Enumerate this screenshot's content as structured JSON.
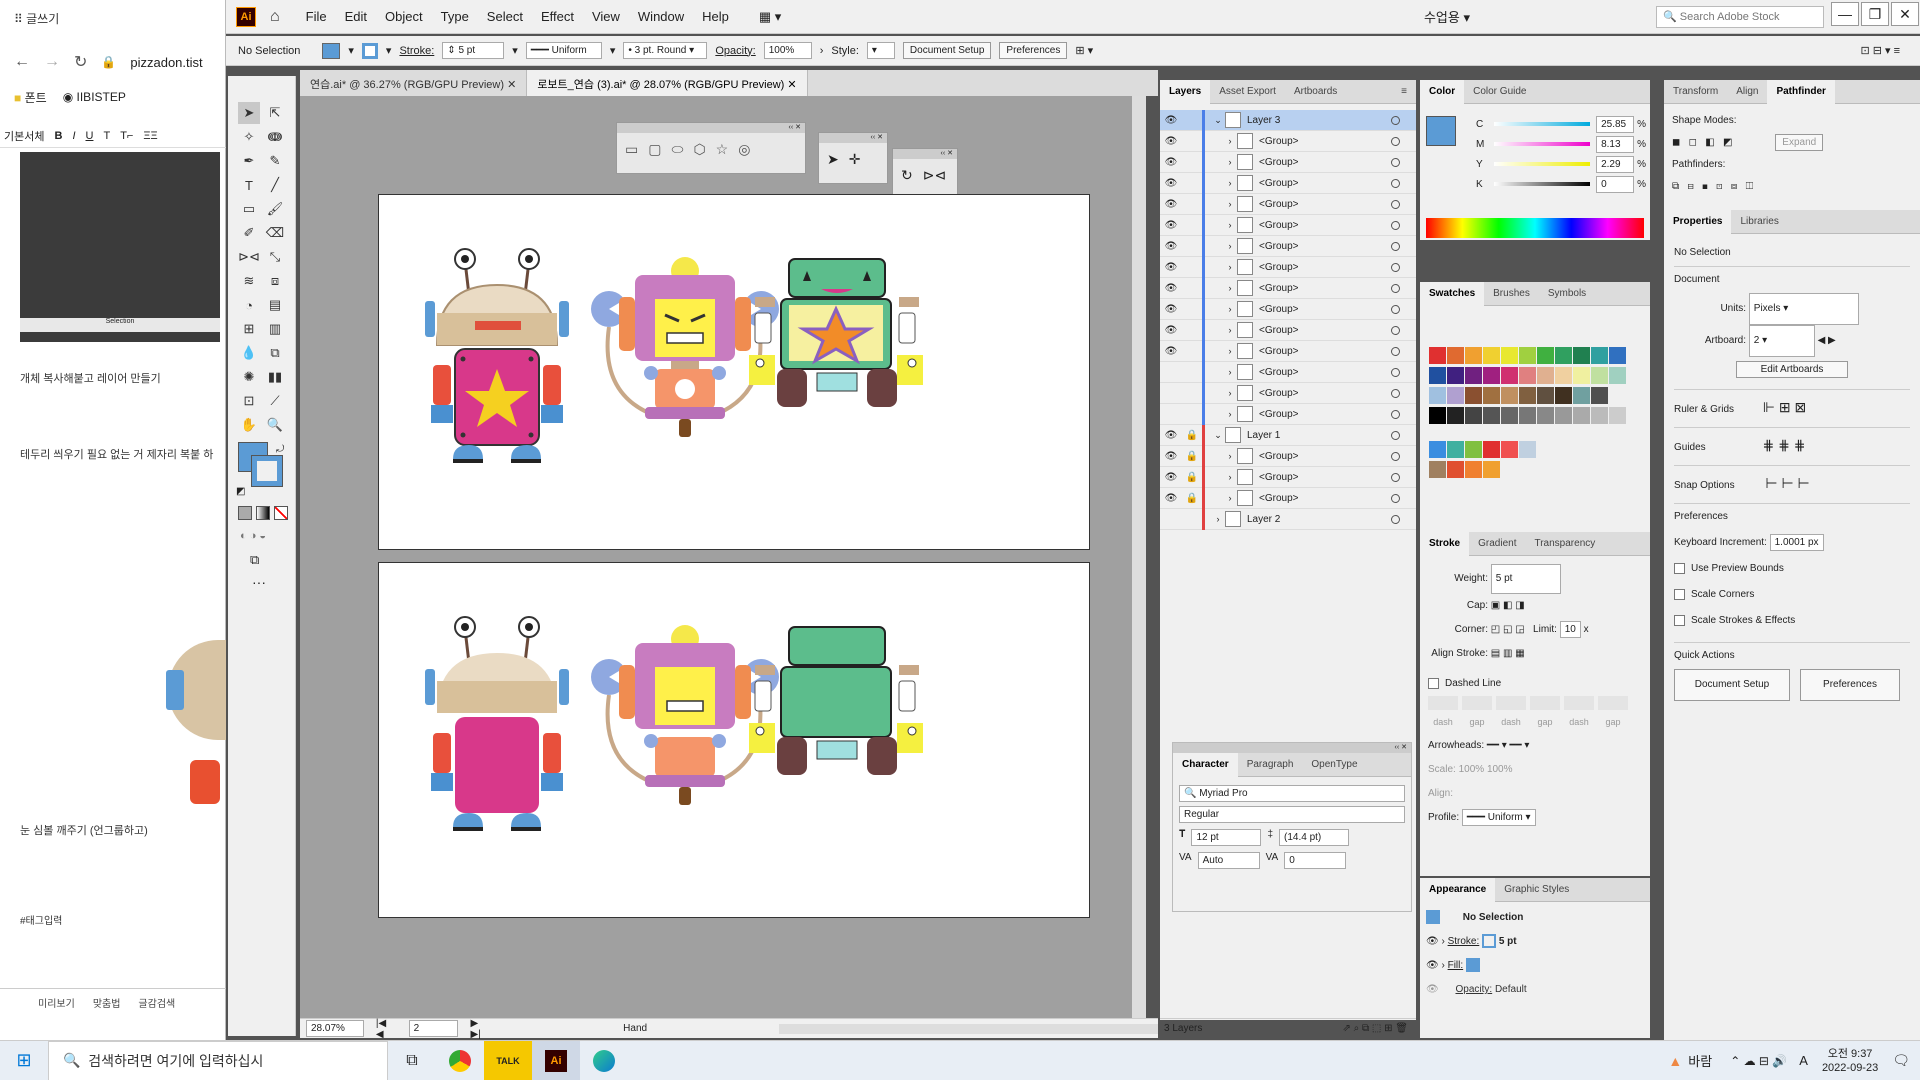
{
  "browser": {
    "tab_title": "글쓰기",
    "url": "pizzadon.tist",
    "bookmarks": [
      "폰트",
      "IIBISTEP"
    ],
    "editor_items": [
      "기본서체",
      "B",
      "I",
      "U",
      "T",
      "T⌐",
      "ΞΞ"
    ],
    "thumb_label": "Selection",
    "post_lines": [
      "개체 복사해붙고 레이어 만들기",
      "테두리 씌우기 필요 없는 거 제자리 복붙 하",
      "눈 심볼 깨주기 (언그룹하고)",
      "#태그입력"
    ],
    "footer": [
      "미리보기",
      "맞춤법",
      "글감검색"
    ]
  },
  "menubar": {
    "logo": "Ai",
    "items": [
      "File",
      "Edit",
      "Object",
      "Type",
      "Select",
      "Effect",
      "View",
      "Window",
      "Help"
    ],
    "workspace": "수업용",
    "search_placeholder": "Search Adobe Stock",
    "win_buttons": [
      "—",
      "❐",
      "✕"
    ]
  },
  "control": {
    "selection": "No Selection",
    "stroke_label": "Stroke:",
    "stroke_value": "5 pt",
    "stroke_style": "Uniform",
    "brush": "3 pt. Round",
    "opacity_label": "Opacity:",
    "opacity": "100%",
    "style_label": "Style:",
    "doc_setup": "Document Setup",
    "preferences": "Preferences"
  },
  "doc_tabs": [
    {
      "label": "연습.ai* @ 36.27% (RGB/GPU Preview)",
      "close": "✕"
    },
    {
      "label": "로보트_연습 (3).ai* @ 28.07% (RGB/GPU Preview)",
      "close": "✕"
    }
  ],
  "status": {
    "zoom": "28.07%",
    "artboard": "2",
    "tool": "Hand"
  },
  "layers_panel": {
    "tabs": [
      "Layers",
      "Asset Export",
      "Artboards"
    ],
    "rows": [
      {
        "name": "Layer 3",
        "level": 0,
        "lock": false,
        "eye": true,
        "open": true
      },
      {
        "name": "<Group>",
        "level": 1,
        "eye": true
      },
      {
        "name": "<Group>",
        "level": 1,
        "eye": true
      },
      {
        "name": "<Group>",
        "level": 1,
        "eye": true
      },
      {
        "name": "<Group>",
        "level": 1,
        "eye": true
      },
      {
        "name": "<Group>",
        "level": 1,
        "eye": true
      },
      {
        "name": "<Group>",
        "level": 1,
        "eye": true
      },
      {
        "name": "<Group>",
        "level": 1,
        "eye": true
      },
      {
        "name": "<Group>",
        "level": 1,
        "eye": true
      },
      {
        "name": "<Group>",
        "level": 1,
        "eye": true
      },
      {
        "name": "<Group>",
        "level": 1,
        "eye": true
      },
      {
        "name": "<Group>",
        "level": 1,
        "eye": true
      },
      {
        "name": "<Group>",
        "level": 1,
        "eye": false
      },
      {
        "name": "<Group>",
        "level": 1,
        "eye": false
      },
      {
        "name": "<Group>",
        "level": 1,
        "eye": false
      },
      {
        "name": "Layer 1",
        "level": 0,
        "lock": true,
        "eye": true,
        "open": true
      },
      {
        "name": "<Group>",
        "level": 1,
        "eye": true,
        "lock": true
      },
      {
        "name": "<Group>",
        "level": 1,
        "eye": true,
        "lock": true
      },
      {
        "name": "<Group>",
        "level": 1,
        "eye": true,
        "lock": true
      },
      {
        "name": "Layer 2",
        "level": 0,
        "eye": false,
        "open": false
      }
    ],
    "footer": "3 Layers"
  },
  "character_panel": {
    "tabs": [
      "Character",
      "Paragraph",
      "OpenType"
    ],
    "font": "Myriad Pro",
    "style": "Regular",
    "size": "12 pt",
    "leading": "(14.4 pt)",
    "kerning": "Auto",
    "tracking": "0"
  },
  "color_panel": {
    "tabs": [
      "Color",
      "Color Guide"
    ],
    "channels": [
      {
        "k": "C",
        "v": "25.85"
      },
      {
        "k": "M",
        "v": "8.13"
      },
      {
        "k": "Y",
        "v": "2.29"
      },
      {
        "k": "K",
        "v": "0"
      }
    ],
    "unit": "%"
  },
  "swatches_panel": {
    "tabs": [
      "Swatches",
      "Brushes",
      "Symbols"
    ],
    "colors": [
      "#e03030",
      "#e06a30",
      "#f0a030",
      "#f0d030",
      "#e8e830",
      "#a0d040",
      "#40b040",
      "#30a060",
      "#208050",
      "#30a0a0",
      "#3070c0",
      "#2050a0",
      "#402080",
      "#702080",
      "#a02080",
      "#d03070",
      "#e08080",
      "#e0b090",
      "#f0d0a0",
      "#f0f0a0",
      "#c0e0a0",
      "#a0d0c0",
      "#a0c0e0",
      "#b0a0d0",
      "#8a5030",
      "#a07040",
      "#c09060",
      "#806040",
      "#605040",
      "#403020",
      "#70a0a0",
      "#505050"
    ],
    "grays": [
      "#000",
      "#222",
      "#444",
      "#555",
      "#666",
      "#777",
      "#888",
      "#999",
      "#aaa",
      "#bbb",
      "#ccc"
    ],
    "group": [
      "#3b8ee0",
      "#40b0a0",
      "#80c040",
      "#e03030",
      "#f05050",
      "#c0d0e0"
    ],
    "group2": [
      "#a08060",
      "#e05030",
      "#f08030",
      "#f0a030"
    ]
  },
  "stroke_panel": {
    "tabs": [
      "Stroke",
      "Gradient",
      "Transparency"
    ],
    "weight_label": "Weight:",
    "weight": "5 pt",
    "cap_label": "Cap:",
    "corner_label": "Corner:",
    "limit_label": "Limit:",
    "limit": "10",
    "limit_unit": "x",
    "align_label": "Align Stroke:",
    "dashed": "Dashed Line",
    "dash_labels": [
      "dash",
      "gap",
      "dash",
      "gap",
      "dash",
      "gap"
    ],
    "arrowheads": "Arrowheads:",
    "scale": "Scale:",
    "scale1": "100%",
    "scale2": "100%",
    "align2": "Align:",
    "profile": "Profile:",
    "profile_value": "Uniform"
  },
  "appearance_panel": {
    "tabs": [
      "Appearance",
      "Graphic Styles"
    ],
    "title": "No Selection",
    "stroke": "Stroke:",
    "stroke_val": "5 pt",
    "fill": "Fill:",
    "opacity": "Opacity:",
    "opacity_val": "Default"
  },
  "right_panel": {
    "tabs": [
      "Transform",
      "Align",
      "Pathfinder"
    ],
    "shape_modes": "Shape Modes:",
    "expand": "Expand",
    "pathfinders": "Pathfinders:",
    "prop_tabs": [
      "Properties",
      "Libraries"
    ],
    "no_selection": "No Selection",
    "document": "Document",
    "units_label": "Units:",
    "units": "Pixels",
    "artboard_label": "Artboard:",
    "artboard": "2",
    "edit_artboards": "Edit Artboards",
    "ruler": "Ruler & Grids",
    "guides": "Guides",
    "snap": "Snap Options",
    "prefs": "Preferences",
    "kb_label": "Keyboard Increment:",
    "kb": "1.0001 px",
    "checks": [
      "Use Preview Bounds",
      "Scale Corners",
      "Scale Strokes & Effects"
    ],
    "quick": "Quick Actions",
    "qa_doc": "Document Setup",
    "qa_pref": "Preferences"
  },
  "taskbar": {
    "search_placeholder": "검색하려면 여기에 입력하십시",
    "weather": "바람",
    "time": "오전 9:37",
    "date": "2022-09-23",
    "lang": "A"
  },
  "colors": {
    "accent": "#4a90d9",
    "fill_swatch": "#5b9bd5"
  }
}
